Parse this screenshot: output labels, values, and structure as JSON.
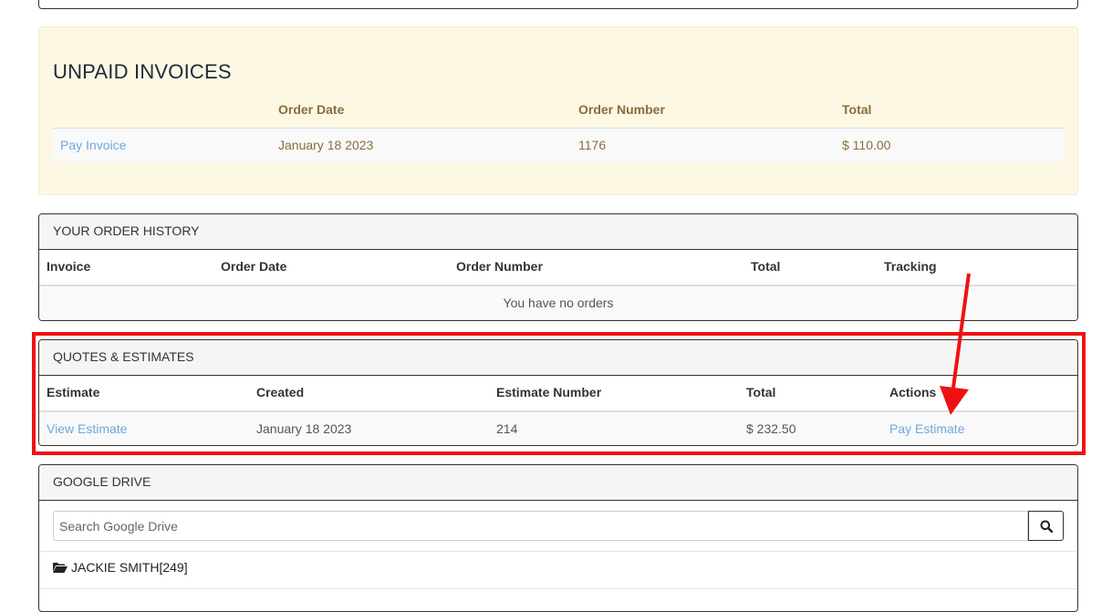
{
  "unpaid_invoices": {
    "title": "UNPAID INVOICES",
    "columns": [
      "",
      "Order Date",
      "Order Number",
      "Total"
    ],
    "rows": [
      {
        "action": "Pay Invoice",
        "order_date": "January 18 2023",
        "order_number": "1176",
        "total": "$ 110.00"
      }
    ]
  },
  "order_history": {
    "title": "YOUR ORDER HISTORY",
    "columns": [
      "Invoice",
      "Order Date",
      "Order Number",
      "Total",
      "Tracking"
    ],
    "empty_message": "You have no orders"
  },
  "quotes": {
    "title": "QUOTES & ESTIMATES",
    "columns": [
      "Estimate",
      "Created",
      "Estimate Number",
      "Total",
      "Actions"
    ],
    "rows": [
      {
        "view": "View Estimate",
        "created": "January 18 2023",
        "number": "214",
        "total": "$ 232.50",
        "action": "Pay Estimate"
      }
    ]
  },
  "google_drive": {
    "title": "GOOGLE DRIVE",
    "search_placeholder": "Search Google Drive",
    "search_icon": "search-icon",
    "folders": [
      {
        "icon": "folder-open-icon",
        "label": "JACKIE SMITH[249]"
      }
    ]
  },
  "colors": {
    "highlight": "#ee1111",
    "link": "#6fa8dc",
    "warning_bg": "#fcf8e3",
    "warning_text": "#8a6d3b"
  }
}
